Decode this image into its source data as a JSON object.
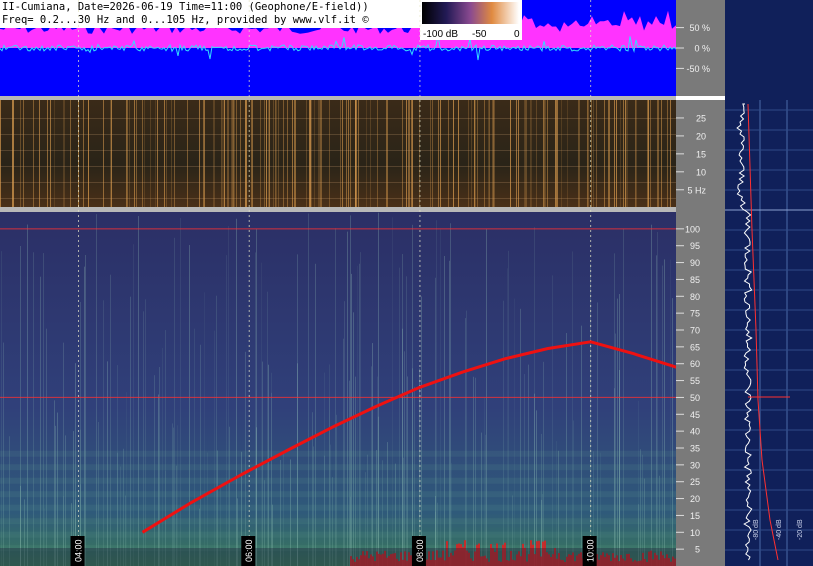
{
  "header": {
    "line1": "II-Cumiana, Date=2026-06-19 Time=11:00 (Geophone/E-field))",
    "line2": "Freq= 0.2...30 Hz and 0...105 Hz, provided by www.vlf.it ©"
  },
  "colorbar": {
    "ticks": [
      "-100 dB",
      "-50",
      "0"
    ]
  },
  "colors": {
    "magenta": "#ff33ff",
    "blue": "#0000ff",
    "cyan": "#33ddff",
    "curve": "#ee1111",
    "spec_dark": "#2a2f5e",
    "spec_top": "#2a2418",
    "panel": "#10205a"
  },
  "chart_data": [
    {
      "type": "area",
      "panel": "amplitude",
      "y_ticks": [
        "50 %",
        "0 %",
        "-50 %"
      ],
      "ylim": [
        -100,
        100
      ]
    },
    {
      "type": "heatmap",
      "panel": "spectrogram-low",
      "y_ticks": [
        "25",
        "20",
        "15",
        "10",
        "5 Hz"
      ],
      "ylim": [
        0.2,
        30
      ]
    },
    {
      "type": "line",
      "panel": "spectrogram-main",
      "x_ticks": [
        "04:00",
        "06:00",
        "08:00",
        "10:00"
      ],
      "x_hours": [
        4,
        6,
        8,
        10
      ],
      "xlim": [
        3.08,
        11.0
      ],
      "y_ticks": [
        "100",
        "95",
        "90",
        "85",
        "80",
        "75",
        "70",
        "65",
        "60",
        "55",
        "50",
        "45",
        "40",
        "35",
        "30",
        "25",
        "20",
        "15",
        "10",
        "5"
      ],
      "y_tick_values": [
        100,
        95,
        90,
        85,
        80,
        75,
        70,
        65,
        60,
        55,
        50,
        45,
        40,
        35,
        30,
        25,
        20,
        15,
        10,
        5
      ],
      "ylim": [
        0,
        105
      ],
      "hlines": [
        100,
        50
      ],
      "series": [
        {
          "x": [
            4.75,
            5.3,
            5.9,
            6.5,
            7.0,
            7.5,
            8.0,
            8.5,
            9.0,
            9.5,
            10.0,
            10.5,
            11.0,
            11.55,
            12.0
          ],
          "y": [
            10,
            18.5,
            27,
            35,
            41.5,
            47.5,
            53,
            57.5,
            61.5,
            64.5,
            66.5,
            63,
            59,
            53,
            37
          ]
        }
      ]
    },
    {
      "type": "line",
      "panel": "side-profile",
      "x_ticks": [
        "-80 dB",
        "-40 dB",
        "-20 dB"
      ]
    }
  ]
}
